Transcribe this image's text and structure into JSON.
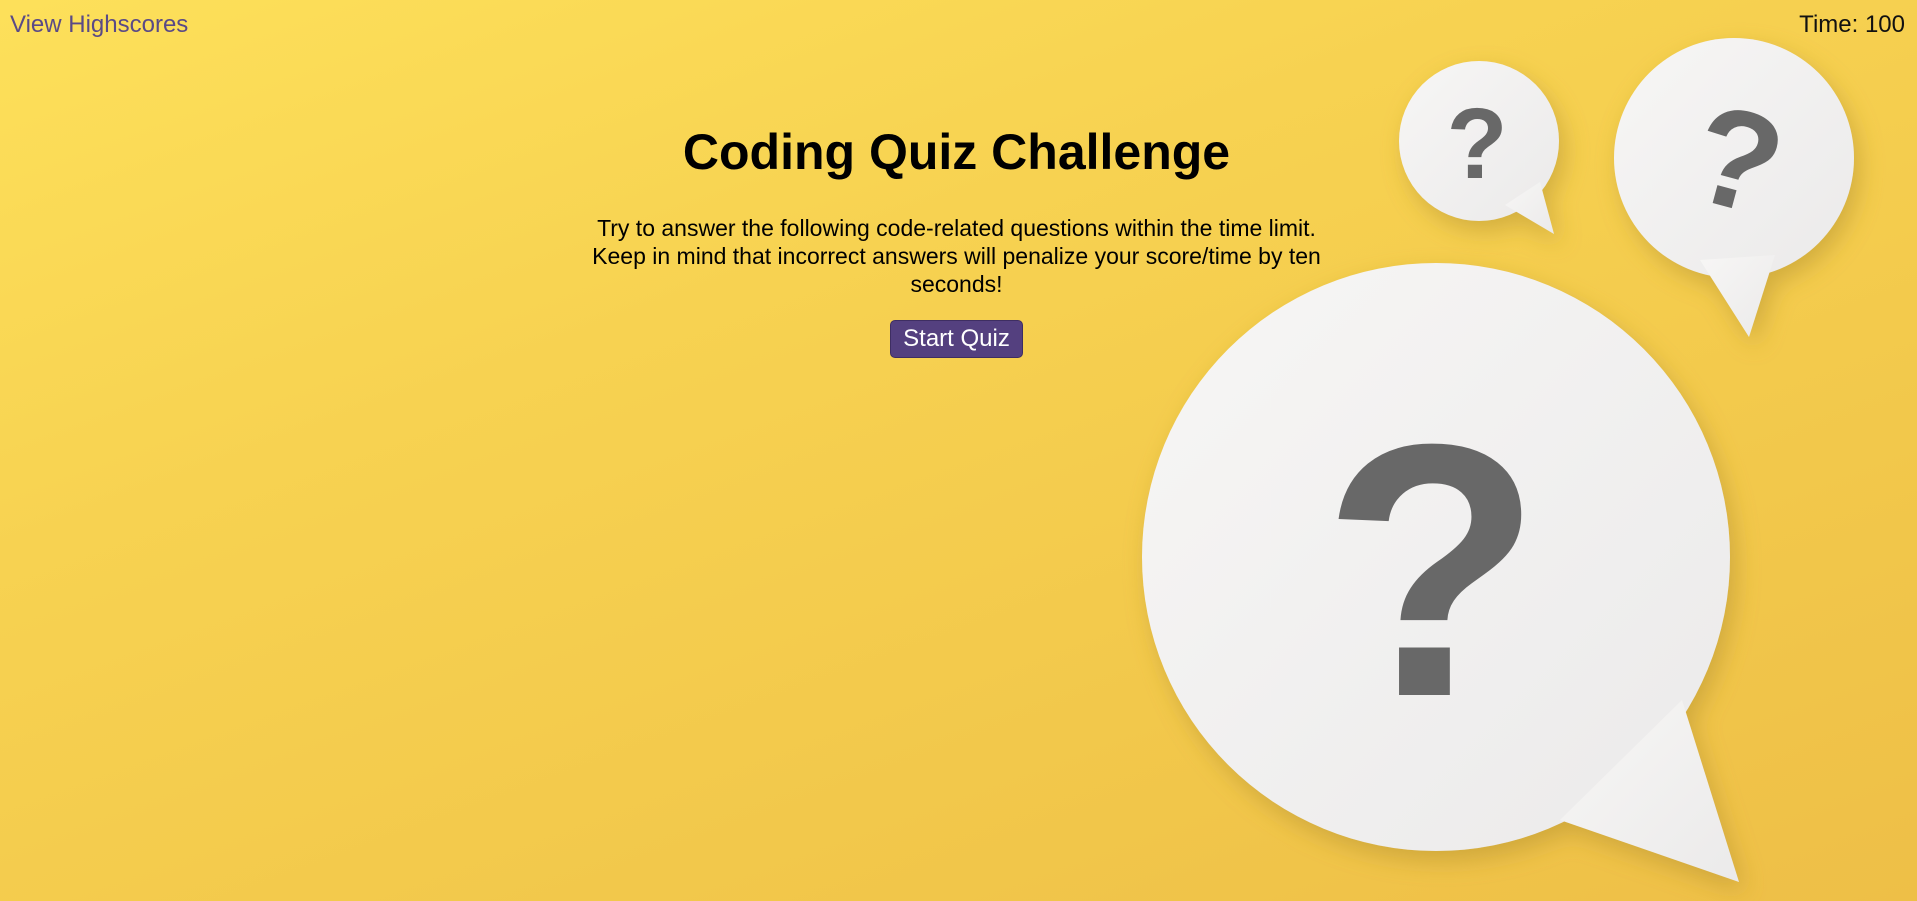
{
  "header": {
    "highscores_link": "View Highscores",
    "timer_label": "Time:",
    "timer_value": "100"
  },
  "intro": {
    "title": "Coding Quiz Challenge",
    "description": "Try to answer the following code-related questions within the time limit. Keep in mind that incorrect answers will penalize your score/time by ten seconds!",
    "start_button": "Start Quiz"
  },
  "decoration": {
    "icons": [
      "question-bubble-icon",
      "question-bubble-icon",
      "question-bubble-icon"
    ]
  },
  "colors": {
    "background": "#f7d251",
    "accent": "#54407f",
    "link": "#5a4a86",
    "bubble": "#f2f1f0",
    "question_mark": "#686868"
  }
}
